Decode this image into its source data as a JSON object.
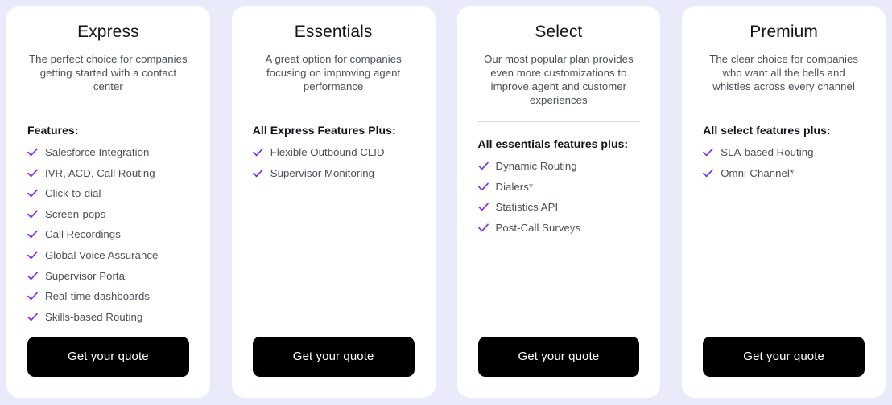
{
  "page": {
    "background_color": "#e9ebfb",
    "card_background": "#ffffff",
    "accent_color": "#7b2ff2",
    "button_color": "#000000",
    "button_text_color": "#ffffff"
  },
  "plans": [
    {
      "name": "Express",
      "description": "The perfect choice for companies getting started with a contact center",
      "features_heading": "Features:",
      "features": [
        "Salesforce Integration",
        "IVR, ACD, Call Routing",
        "Click-to-dial",
        "Screen-pops",
        "Call Recordings",
        "Global Voice Assurance",
        "Supervisor Portal",
        "Real-time dashboards",
        "Skills-based Routing"
      ],
      "cta_label": "Get your quote"
    },
    {
      "name": "Essentials",
      "description": "A great option for companies focusing on improving agent performance",
      "features_heading": "All Express Features Plus:",
      "features": [
        "Flexible Outbound CLID",
        "Supervisor Monitoring"
      ],
      "cta_label": "Get your quote"
    },
    {
      "name": "Select",
      "description": "Our most popular plan provides even more customizations to improve agent and customer experiences",
      "features_heading": "All essentials features plus:",
      "features": [
        "Dynamic Routing",
        "Dialers*",
        "Statistics API",
        "Post-Call Surveys"
      ],
      "cta_label": "Get your quote"
    },
    {
      "name": "Premium",
      "description": "The clear choice for companies who want all the bells and whistles across every channel",
      "features_heading": "All select features plus:",
      "features": [
        "SLA-based Routing",
        "Omni-Channel*"
      ],
      "cta_label": "Get your quote"
    }
  ]
}
